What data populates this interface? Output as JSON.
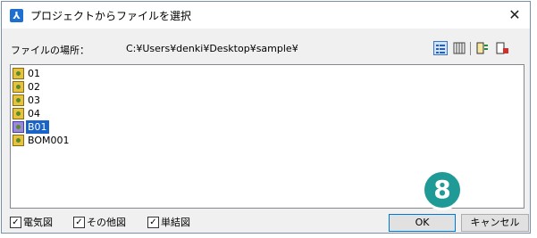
{
  "window": {
    "title": "プロジェクトからファイルを選択",
    "close_glyph": "✕",
    "app_icon": "⅄"
  },
  "path": {
    "label": "ファイルの場所：",
    "value": "C:¥Users¥denki¥Desktop¥sample¥"
  },
  "toolbar": {
    "icons": [
      "list-view-icon",
      "details-view-icon",
      "tool-icon-a",
      "tool-icon-b"
    ]
  },
  "files": [
    {
      "name": "01",
      "selected": false
    },
    {
      "name": "02",
      "selected": false
    },
    {
      "name": "03",
      "selected": false
    },
    {
      "name": "04",
      "selected": false
    },
    {
      "name": "B01",
      "selected": true
    },
    {
      "name": "BOM001",
      "selected": false
    }
  ],
  "filters": [
    {
      "label": "電気図",
      "checked": true
    },
    {
      "label": "その他図",
      "checked": true
    },
    {
      "label": "単結図",
      "checked": true
    }
  ],
  "buttons": {
    "ok": "OK",
    "cancel": "キャンセル"
  },
  "annotation": {
    "step": "8",
    "color": "#1f9a97"
  }
}
